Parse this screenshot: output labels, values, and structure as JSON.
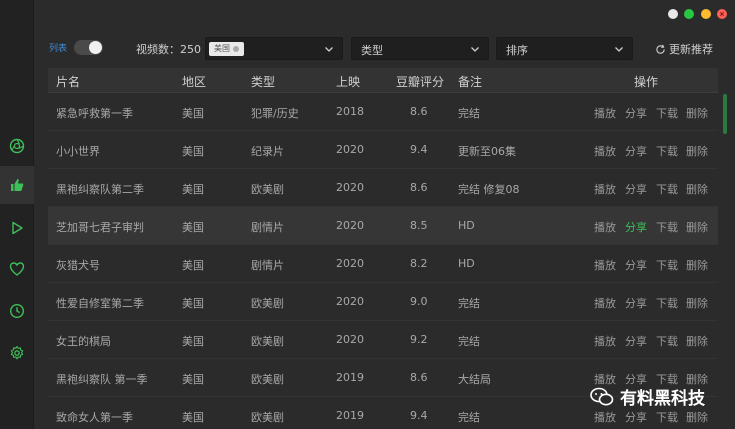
{
  "toolbar": {
    "list_label": "列表",
    "count_label": "视频数：250",
    "region_tag": "美国",
    "type_placeholder": "类型",
    "sort_placeholder": "排序",
    "refresh_label": "更新推荐"
  },
  "table": {
    "headers": {
      "name": "片名",
      "region": "地区",
      "type": "类型",
      "year": "上映",
      "rating": "豆瓣评分",
      "note": "备注",
      "ops": "操作"
    },
    "actions": {
      "play": "播放",
      "share": "分享",
      "download": "下载",
      "delete": "删除"
    },
    "rows": [
      {
        "name": "紧急呼救第一季",
        "region": "美国",
        "type": "犯罪/历史",
        "year": "2018",
        "rating": "8.6",
        "note": "完结"
      },
      {
        "name": "小小世界",
        "region": "美国",
        "type": "纪录片",
        "year": "2020",
        "rating": "9.4",
        "note": "更新至06集"
      },
      {
        "name": "黑袍纠察队第二季",
        "region": "美国",
        "type": "欧美剧",
        "year": "2020",
        "rating": "8.6",
        "note": "完结 修复08"
      },
      {
        "name": "芝加哥七君子审判",
        "region": "美国",
        "type": "剧情片",
        "year": "2020",
        "rating": "8.5",
        "note": "HD"
      },
      {
        "name": "灰猎犬号",
        "region": "美国",
        "type": "剧情片",
        "year": "2020",
        "rating": "8.2",
        "note": "HD"
      },
      {
        "name": "性爱自修室第二季",
        "region": "美国",
        "type": "欧美剧",
        "year": "2020",
        "rating": "9.0",
        "note": "完结"
      },
      {
        "name": "女王的棋局",
        "region": "美国",
        "type": "欧美剧",
        "year": "2020",
        "rating": "9.2",
        "note": "完结"
      },
      {
        "name": "黑袍纠察队 第一季",
        "region": "美国",
        "type": "欧美剧",
        "year": "2019",
        "rating": "8.6",
        "note": "大结局"
      },
      {
        "name": "致命女人第一季",
        "region": "美国",
        "type": "欧美剧",
        "year": "2019",
        "rating": "9.4",
        "note": "完结"
      }
    ],
    "highlighted_row": 3,
    "active_action": "share"
  },
  "watermark": "有料黑科技",
  "colors": {
    "accent_green": "#3fbf5a",
    "accent_blue": "#3d8fd8",
    "close": "#ff5f57",
    "minimize": "#febc2e",
    "maximize": "#28c840",
    "extra": "#e8e8e8"
  },
  "sidebar_icons": [
    "aperture-icon",
    "thumbs-up-icon",
    "play-icon",
    "heart-icon",
    "clock-icon",
    "gear-icon"
  ]
}
